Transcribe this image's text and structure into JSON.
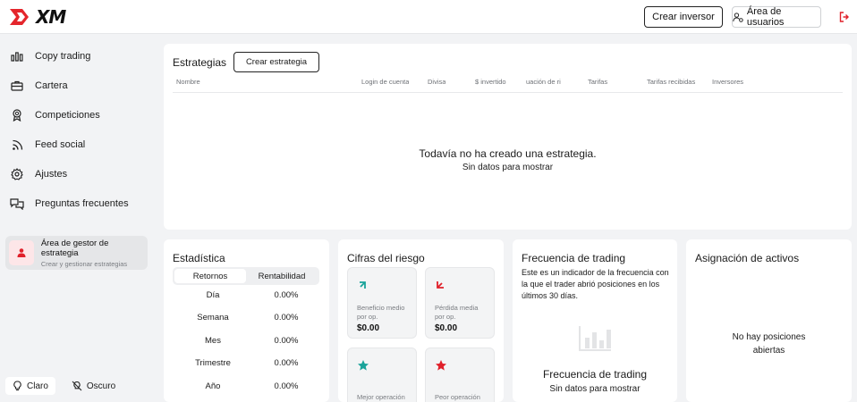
{
  "header": {
    "logo": "XM",
    "create_investor": "Crear inversor",
    "user_area": "Área de usuarios"
  },
  "sidebar": {
    "items": [
      {
        "label": "Copy trading",
        "icon": "bar-chart-icon"
      },
      {
        "label": "Cartera",
        "icon": "briefcase-icon"
      },
      {
        "label": "Competiciones",
        "icon": "award-icon"
      },
      {
        "label": "Feed social",
        "icon": "rss-icon"
      },
      {
        "label": "Ajustes",
        "icon": "gear-icon"
      },
      {
        "label": "Preguntas frecuentes",
        "icon": "chat-icon"
      }
    ],
    "manager": {
      "title": "Área de gestor de estrategia",
      "subtitle": "Crear y gestionar estrategias"
    },
    "theme": {
      "light": "Claro",
      "dark": "Oscuro"
    }
  },
  "strategies": {
    "title": "Estrategias",
    "create_button": "Crear estrategia",
    "columns": [
      "Nombre",
      "Login de cuenta",
      "Divisa",
      "$ invertido",
      "uación de ri",
      "Tarifas",
      "Tarifas recibidas",
      "Inversores"
    ],
    "empty_title": "Todavía no ha creado una estrategia.",
    "empty_sub": "Sin datos para mostrar"
  },
  "stats": {
    "title": "Estadística",
    "tabs": [
      "Retornos",
      "Rentabilidad"
    ],
    "rows": [
      {
        "label": "Día",
        "value": "0.00%"
      },
      {
        "label": "Semana",
        "value": "0.00%"
      },
      {
        "label": "Mes",
        "value": "0.00%"
      },
      {
        "label": "Trimestre",
        "value": "0.00%"
      },
      {
        "label": "Año",
        "value": "0.00%"
      }
    ]
  },
  "risk": {
    "title": "Cifras del riesgo",
    "avg_profit_label": "Beneficio medio por op.",
    "avg_profit_value": "$0.00",
    "avg_loss_label": "Pérdida media por op.",
    "avg_loss_value": "$0.00",
    "best_label": "Mejor operación",
    "worst_label": "Peor operación"
  },
  "frequency": {
    "title": "Frecuencia de trading",
    "description": "Este es un indicador de la frecuencia con la que el trader abrió posiciones en los últimos 30 días.",
    "empty_title": "Frecuencia de trading",
    "empty_sub": "Sin datos para mostrar"
  },
  "assets": {
    "title": "Asignación de activos",
    "empty": "No hay posiciones abiertas"
  },
  "colors": {
    "brand_red": "#e4262c",
    "teal": "#1aa39a",
    "accent_red": "#e0202a"
  }
}
